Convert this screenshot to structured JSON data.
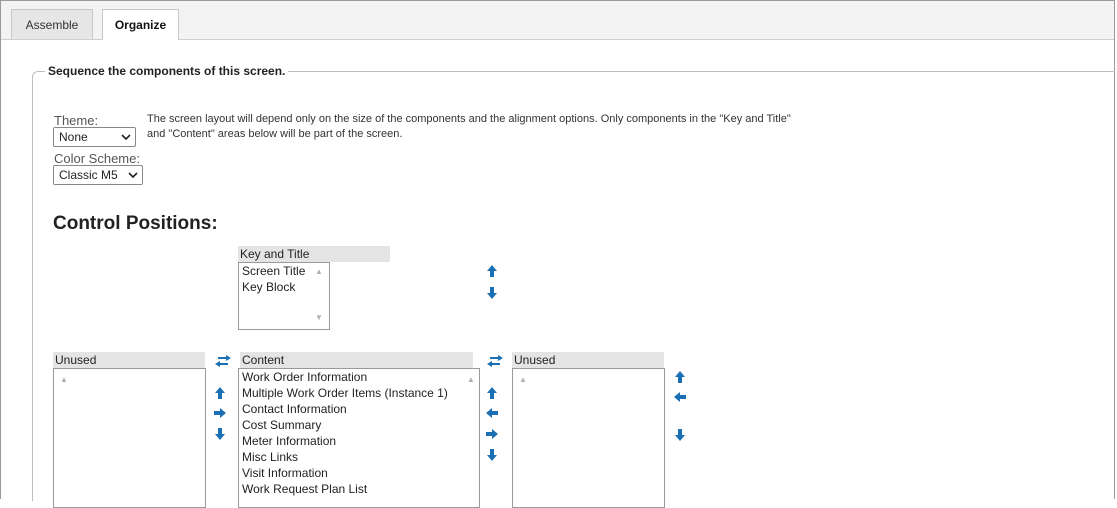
{
  "tabs": [
    {
      "label": "Assemble",
      "active": false
    },
    {
      "label": "Organize",
      "active": true
    }
  ],
  "section_legend": "Sequence the components of this screen.",
  "theme": {
    "label": "Theme:",
    "value": "None"
  },
  "color_scheme": {
    "label": "Color Scheme:",
    "value": "Classic M5"
  },
  "description": {
    "line1": "The screen layout will depend only on the size of the components and the alignment options. Only components in the \"Key and Title\"",
    "line2": "and \"Content\" areas below will be part of the screen."
  },
  "control_positions_heading": "Control Positions:",
  "key_and_title": {
    "header": "Key and Title",
    "items": [
      "Screen Title",
      "Key Block"
    ]
  },
  "unused_left": {
    "header": "Unused",
    "items": []
  },
  "content": {
    "header": "Content",
    "items": [
      "Work Order Information",
      "Multiple Work Order Items (Instance 1)",
      "Contact Information",
      "Cost Summary",
      "Meter Information",
      "Misc Links",
      "Visit Information",
      "Work Request Plan List"
    ]
  },
  "unused_right": {
    "header": "Unused",
    "items": []
  },
  "colors": {
    "arrow_blue": "#1a6fb5",
    "header_gray": "#e4e4e4"
  }
}
